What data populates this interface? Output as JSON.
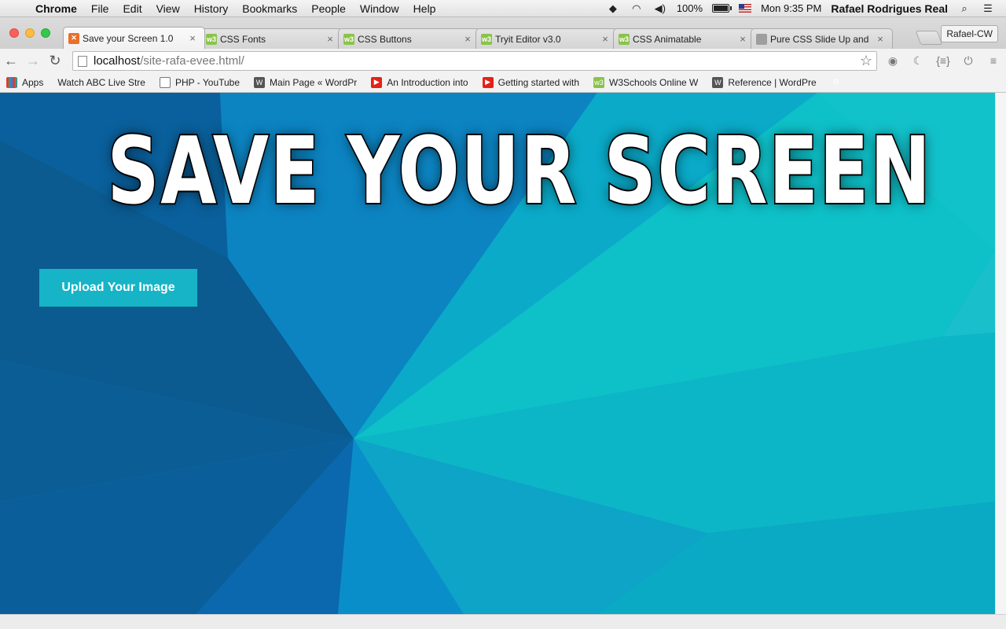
{
  "menubar": {
    "app": "Chrome",
    "items": [
      "File",
      "Edit",
      "View",
      "History",
      "Bookmarks",
      "People",
      "Window",
      "Help"
    ],
    "battery": "100%",
    "battery_level": 1.0,
    "clock": "Mon 9:35 PM",
    "user": "Rafael Rodrigues Real"
  },
  "tabs": [
    {
      "title": "Save your Screen 1.0",
      "icon": "xampp-icon",
      "active": true
    },
    {
      "title": "CSS Fonts",
      "icon": "w3schools-icon"
    },
    {
      "title": "CSS Buttons",
      "icon": "w3schools-icon"
    },
    {
      "title": "Tryit Editor v3.0",
      "icon": "w3schools-icon"
    },
    {
      "title": "CSS Animatable",
      "icon": "w3schools-icon"
    },
    {
      "title": "Pure CSS Slide Up and",
      "icon": "globe-icon"
    }
  ],
  "profile": "Rafael-CW",
  "address": {
    "host": "localhost",
    "path": "/site-rafa-evee.html/"
  },
  "bookmarks": [
    {
      "label": "Apps",
      "icon": "apps-icon"
    },
    {
      "label": "Watch ABC Live Stre",
      "icon": "none"
    },
    {
      "label": "PHP - YouTube",
      "icon": "page-icon"
    },
    {
      "label": "Main Page « WordPr",
      "icon": "wordpress-icon"
    },
    {
      "label": "An Introduction into",
      "icon": "youtube-icon"
    },
    {
      "label": "Getting started with",
      "icon": "youtube-icon"
    },
    {
      "label": "W3Schools Online W",
      "icon": "w3schools-icon"
    },
    {
      "label": "Reference | WordPre",
      "icon": "wordpress-icon"
    }
  ],
  "page": {
    "title": "SAVE YOUR SCREEN",
    "upload_label": "Upload Your Image",
    "colors": {
      "button": "#16b4c6",
      "bg_dark": "#0a5d94",
      "bg_teal": "#0fc0c6"
    }
  }
}
